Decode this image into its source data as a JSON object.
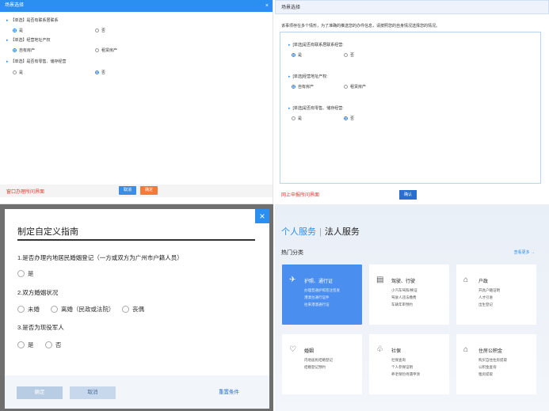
{
  "panel_a": {
    "title": "场景选择",
    "close": "×",
    "questions": [
      {
        "label": "【单选】是否有联系居联系",
        "options": [
          {
            "label": "是",
            "on": true
          },
          {
            "label": "否",
            "on": false
          }
        ]
      },
      {
        "label": "【单选】经营地址产权",
        "options": [
          {
            "label": "自有房产",
            "on": true
          },
          {
            "label": "租赁房产",
            "on": false
          }
        ]
      },
      {
        "label": "【单选】是否有零售、储存经营",
        "options": [
          {
            "label": "是",
            "on": false
          },
          {
            "label": "否",
            "on": true
          }
        ]
      }
    ],
    "footer_link": "窗口办理所问界面",
    "btn_cancel": "取消",
    "btn_ok": "确定"
  },
  "panel_b": {
    "title": "场景选择",
    "description": "该事项存在多个情形，为了准确的推送您的办件信息，请按照您的自身情况选择您的情况。",
    "questions": [
      {
        "label": "[单选]是否有联系居联系经营:",
        "options": [
          {
            "label": "是",
            "on": true
          },
          {
            "label": "否",
            "on": false
          }
        ]
      },
      {
        "label": "[单选]经营地址产权:",
        "options": [
          {
            "label": "自有房产",
            "on": true
          },
          {
            "label": "租赁房产",
            "on": false
          }
        ]
      },
      {
        "label": "[单选]是否有零售、储存经营:",
        "options": [
          {
            "label": "是",
            "on": false
          },
          {
            "label": "否",
            "on": true
          }
        ]
      }
    ],
    "footer_link": "网上申报所问界面",
    "btn_ok": "确认"
  },
  "panel_c": {
    "title": "制定自定义指南",
    "close": "×",
    "q1": "1.是否办理内地居民婚姻登记（一方或双方为广州市户籍人员）",
    "q1_options": [
      "是"
    ],
    "q2": "2.双方婚姻状况",
    "q2_options": [
      "未婚",
      "离婚（民政或法院）",
      "丧偶"
    ],
    "q3": "3.是否为现役军人",
    "q3_options": [
      "是",
      "否"
    ],
    "btn_confirm": "确定",
    "btn_cancel": "取消",
    "btn_reset": "重置条件"
  },
  "panel_d": {
    "tab_personal": "个人服务",
    "tab_separator": "|",
    "tab_corporate": "法人服务",
    "section_title": "热门分类",
    "more_link": "查看更多 →",
    "cards": [
      {
        "title": "护照、通行证",
        "icon": "plane-icon",
        "lines": [
          "办理普通护照签注签发",
          "港澳台通行证件",
          "往来港澳通行证"
        ],
        "active": true
      },
      {
        "title": "驾驶、行驶",
        "icon": "id-card-icon",
        "lines": [
          "小汽车驾照/换证",
          "驾驶人违法缴费",
          "车辆年审预约"
        ],
        "active": false
      },
      {
        "title": "户政",
        "icon": "house-icon",
        "lines": [
          "开具户籍证明",
          "人才引进",
          "出生登记"
        ],
        "active": false
      },
      {
        "title": "婚姻",
        "icon": "heart-icon",
        "lines": [
          "内地居民结婚登记",
          "结婚登记预约"
        ],
        "active": false
      },
      {
        "title": "社保",
        "icon": "hand-heart-icon",
        "lines": [
          "社保查询",
          "个人参保证明",
          "养老保险待遇申领"
        ],
        "active": false
      },
      {
        "title": "住房公积金",
        "icon": "house-coin-icon",
        "lines": [
          "购买自住住房提取",
          "公积金查询",
          "租房提取"
        ],
        "active": false
      }
    ]
  },
  "colors": {
    "primary": "#2a8ff0",
    "danger_link": "#e8362f",
    "orange": "#f47a35",
    "card_active": "#4a8ef0"
  }
}
